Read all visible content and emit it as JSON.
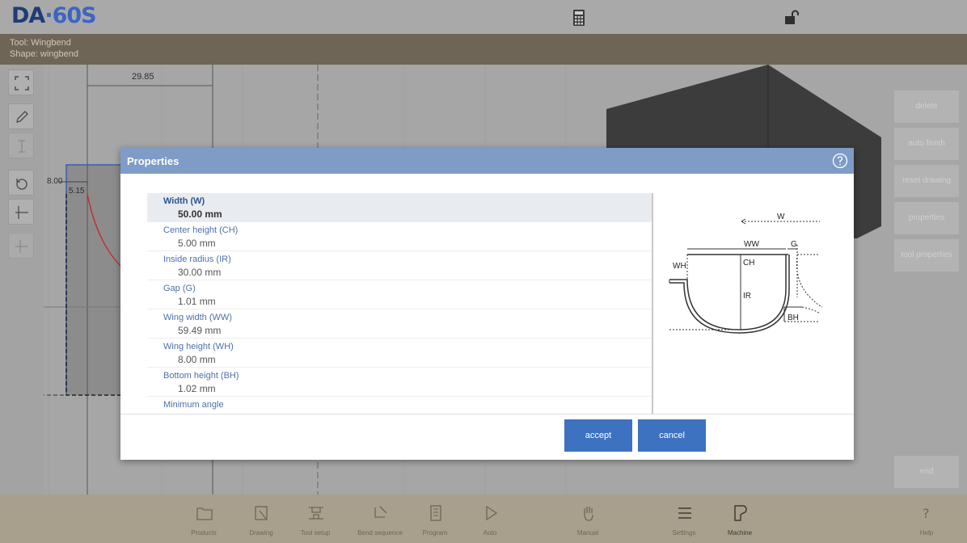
{
  "app": {
    "logo_brand": "DA",
    "logo_model": "·60S"
  },
  "info": {
    "tool_line": "Tool: Wingbend",
    "shape_line": "Shape: wingbend"
  },
  "drawing": {
    "dim_top": "29.85",
    "dim_left": "8.00",
    "dim_inner": "5.15"
  },
  "side_buttons": [
    "delete",
    "auto finish",
    "reset drawing",
    "properties",
    "tool properties",
    "end"
  ],
  "dialog": {
    "title": "Properties",
    "properties": [
      {
        "label": "Width (W)",
        "value": "50.00 mm"
      },
      {
        "label": "Center height (CH)",
        "value": "5.00 mm"
      },
      {
        "label": "Inside radius (IR)",
        "value": "30.00 mm"
      },
      {
        "label": "Gap (G)",
        "value": "1.01 mm"
      },
      {
        "label": "Wing width (WW)",
        "value": "59.49 mm"
      },
      {
        "label": "Wing height (WH)",
        "value": "8.00 mm"
      },
      {
        "label": "Bottom height (BH)",
        "value": "1.02 mm"
      },
      {
        "label": "Minimum angle",
        "value": ""
      }
    ],
    "selected_index": 0,
    "accept_label": "accept",
    "cancel_label": "cancel",
    "diagram_labels": {
      "w": "W",
      "ww": "WW",
      "g": "G",
      "wh": "WH",
      "ch": "CH",
      "ir": "IR",
      "bh": "BH"
    }
  },
  "nav": [
    {
      "label": "Products",
      "icon": "folder-icon"
    },
    {
      "label": "Drawing",
      "icon": "drawing-icon"
    },
    {
      "label": "Tool setup",
      "icon": "tool-setup-icon"
    },
    {
      "label": "Bend sequence",
      "icon": "bend-sequence-icon"
    },
    {
      "label": "Program",
      "icon": "program-icon"
    },
    {
      "label": "Auto",
      "icon": "play-icon"
    },
    {
      "label": "Manual",
      "icon": "hand-icon"
    },
    {
      "label": "Settings",
      "icon": "list-icon"
    },
    {
      "label": "Machine",
      "icon": "machine-icon"
    },
    {
      "label": "Help",
      "icon": "help-icon"
    }
  ],
  "colors": {
    "accent": "#3d72c0",
    "header": "#7f9cc7",
    "logo": "#1f3c78"
  }
}
